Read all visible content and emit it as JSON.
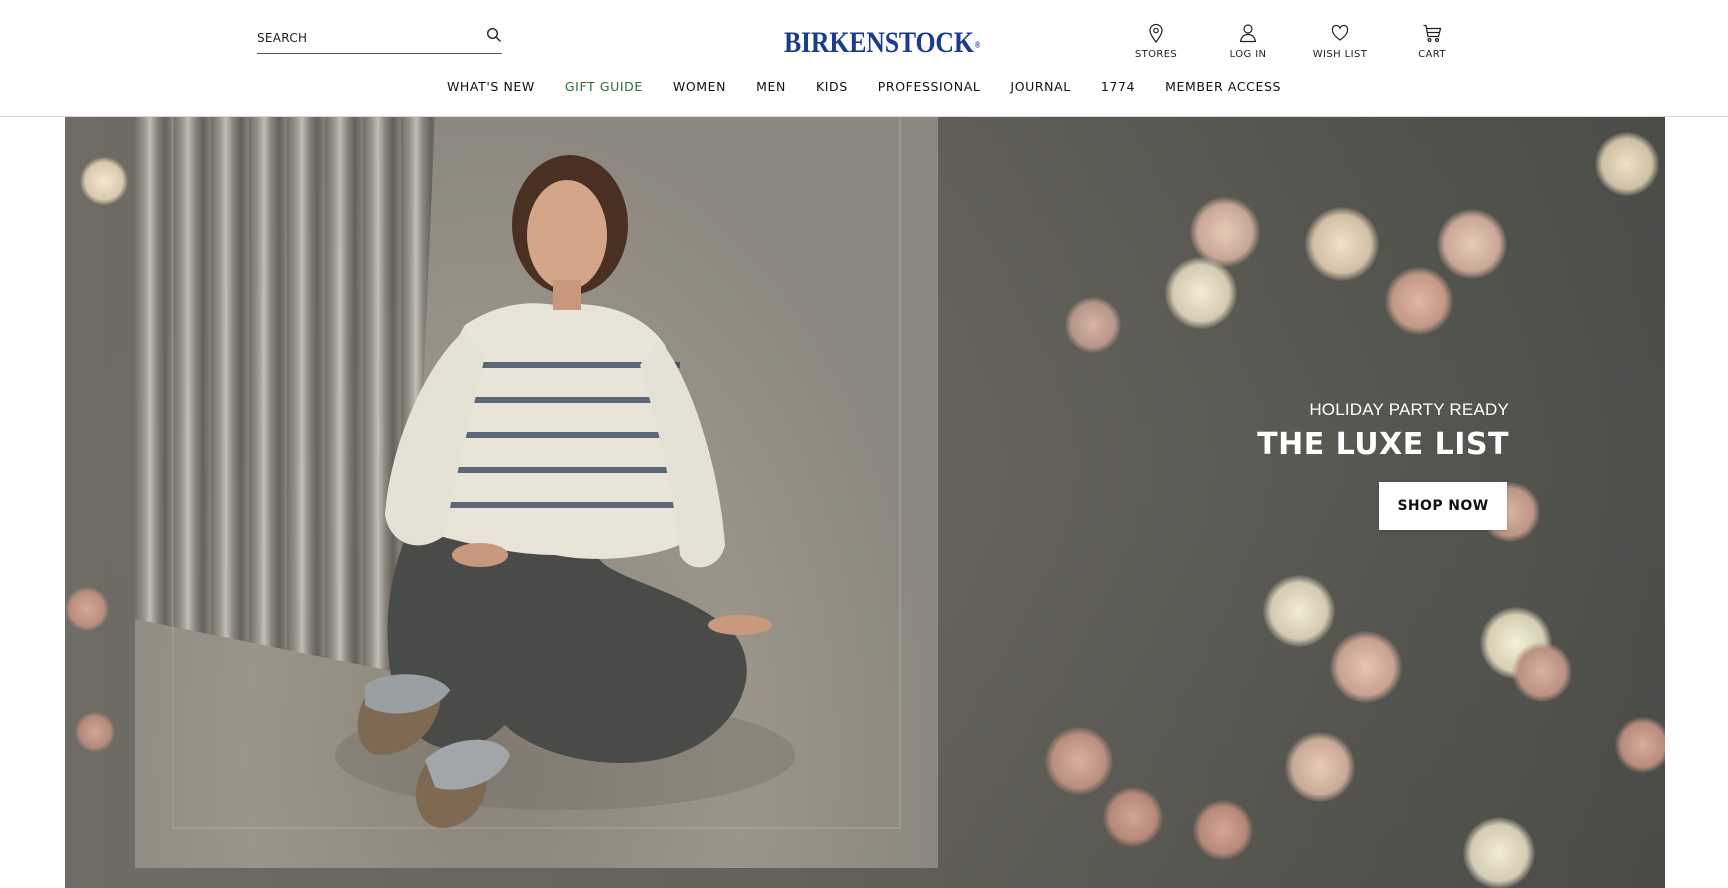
{
  "header": {
    "search": {
      "placeholder": "SEARCH",
      "icon": "search-icon"
    },
    "logo": {
      "text": "BIRKENSTOCK",
      "mark": "®",
      "color": "#1a3c8c"
    },
    "utility": [
      {
        "label": "STORES",
        "icon": "map-pin-icon"
      },
      {
        "label": "LOG IN",
        "icon": "user-icon"
      },
      {
        "label": "WISH LIST",
        "icon": "heart-icon"
      },
      {
        "label": "CART",
        "icon": "cart-icon"
      }
    ]
  },
  "nav": {
    "items": [
      {
        "label": "WHAT'S NEW"
      },
      {
        "label": "GIFT GUIDE",
        "accent": "#2e6b3c"
      },
      {
        "label": "WOMEN"
      },
      {
        "label": "MEN"
      },
      {
        "label": "KIDS"
      },
      {
        "label": "PROFESSIONAL"
      },
      {
        "label": "JOURNAL"
      },
      {
        "label": "1774"
      },
      {
        "label": "MEMBER ACCESS"
      }
    ]
  },
  "hero": {
    "eyebrow": "HOLIDAY PARTY READY",
    "title": "THE LUXE LIST",
    "cta": "SHOP NOW"
  }
}
